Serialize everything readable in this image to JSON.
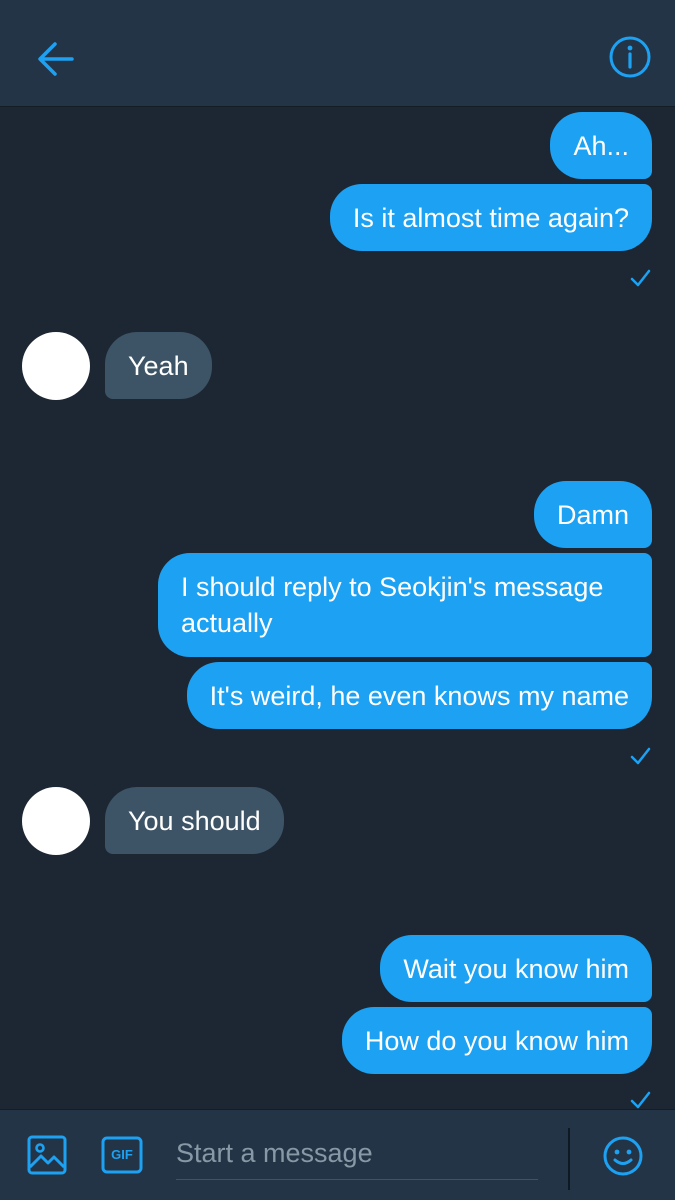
{
  "colors": {
    "accent": "#1da1f2",
    "background": "#1c2733",
    "header": "#243447",
    "incoming_bubble": "#3d5466",
    "placeholder": "#8899a6"
  },
  "header": {
    "back_icon": "arrow-left-icon",
    "info_icon": "info-icon"
  },
  "messages": [
    {
      "direction": "out",
      "text": "Ah..."
    },
    {
      "direction": "out",
      "text": "Is it almost time again?"
    },
    {
      "direction": "in",
      "text": "Yeah"
    },
    {
      "direction": "out",
      "text": "Damn"
    },
    {
      "direction": "out",
      "text": "I should reply to Seokjin's message actually"
    },
    {
      "direction": "out",
      "text": "It's weird, he even knows my name"
    },
    {
      "direction": "in",
      "text": "You should"
    },
    {
      "direction": "out",
      "text": "Wait you know him"
    },
    {
      "direction": "out",
      "text": "How do you know him"
    }
  ],
  "composer": {
    "placeholder": "Start a message",
    "gif_label": "GIF",
    "image_icon": "image-icon",
    "emoji_icon": "emoji-icon"
  }
}
